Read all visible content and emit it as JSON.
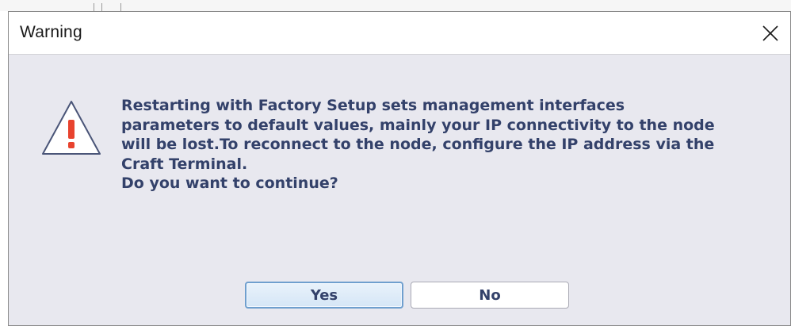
{
  "dialog": {
    "title": "Warning",
    "message": "Restarting with Factory Setup sets management interfaces\nparameters to default values, mainly your IP connectivity to the node\nwill be lost.To reconnect to the node, configure the IP address via the\nCraft Terminal.\nDo you want to continue?",
    "icon": "warning-triangle-icon",
    "buttons": {
      "yes_label": "Yes",
      "no_label": "No"
    }
  },
  "colors": {
    "text": "#33416a",
    "dialog_bg": "#e8e8ef",
    "warning_red": "#e8432e",
    "focus_border": "#6f9fce"
  }
}
